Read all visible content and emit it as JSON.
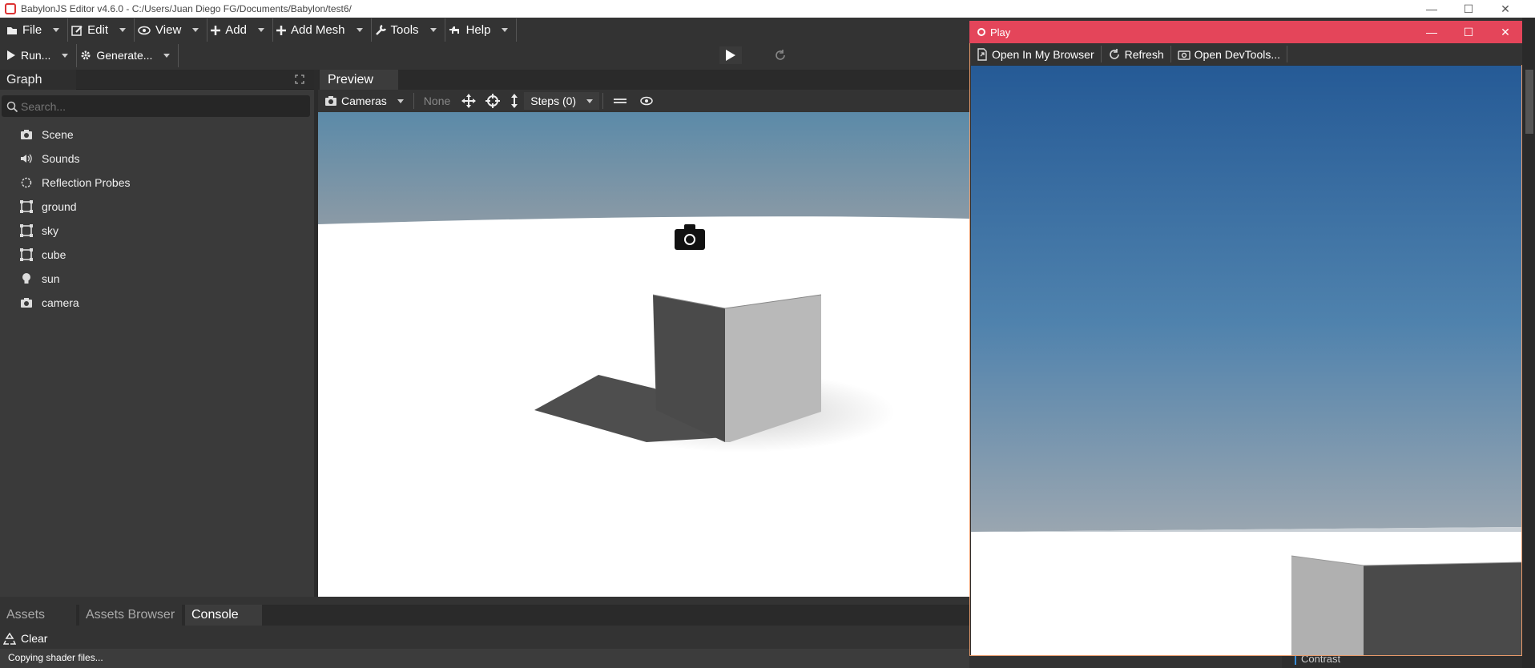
{
  "window": {
    "title": "BabylonJS Editor v4.6.0 - C:/Users/Juan Diego FG/Documents/Babylon/test6/"
  },
  "menubar": {
    "items": [
      {
        "label": "File",
        "icon": "file-icon"
      },
      {
        "label": "Edit",
        "icon": "edit-icon"
      },
      {
        "label": "View",
        "icon": "eye-icon"
      },
      {
        "label": "Add",
        "icon": "plus-icon"
      },
      {
        "label": "Add Mesh",
        "icon": "plus-icon"
      },
      {
        "label": "Tools",
        "icon": "wrench-icon"
      },
      {
        "label": "Help",
        "icon": "dog-icon"
      }
    ]
  },
  "toolbar": {
    "run_label": "Run...",
    "generate_label": "Generate..."
  },
  "graph": {
    "title": "Graph",
    "search_placeholder": "Search...",
    "items": [
      {
        "label": "Scene",
        "icon": "camera-icon"
      },
      {
        "label": "Sounds",
        "icon": "speaker-icon"
      },
      {
        "label": "Reflection Probes",
        "icon": "probe-icon"
      },
      {
        "label": "ground",
        "icon": "mesh-icon"
      },
      {
        "label": "sky",
        "icon": "mesh-icon"
      },
      {
        "label": "cube",
        "icon": "mesh-icon"
      },
      {
        "label": "sun",
        "icon": "light-bulb-icon"
      },
      {
        "label": "camera",
        "icon": "camera-icon"
      }
    ]
  },
  "preview": {
    "tab_label": "Preview",
    "cameras_label": "Cameras",
    "gizmo_none_label": "None",
    "steps_label": "Steps (0)"
  },
  "bottom": {
    "tabs": [
      "Assets",
      "Assets Browser",
      "Console"
    ],
    "active_tab": "Console",
    "clear_label": "Clear",
    "console_line": "Copying shader files..."
  },
  "play": {
    "title": "Play",
    "open_browser_label": "Open In My Browser",
    "refresh_label": "Refresh",
    "devtools_label": "Open DevTools..."
  },
  "inspector": {
    "contrast_label": "Contrast"
  },
  "colors": {
    "play_titlebar": "#e4455a",
    "sky_top": "#255a96",
    "sky_bottom": "#9aa6b0"
  }
}
